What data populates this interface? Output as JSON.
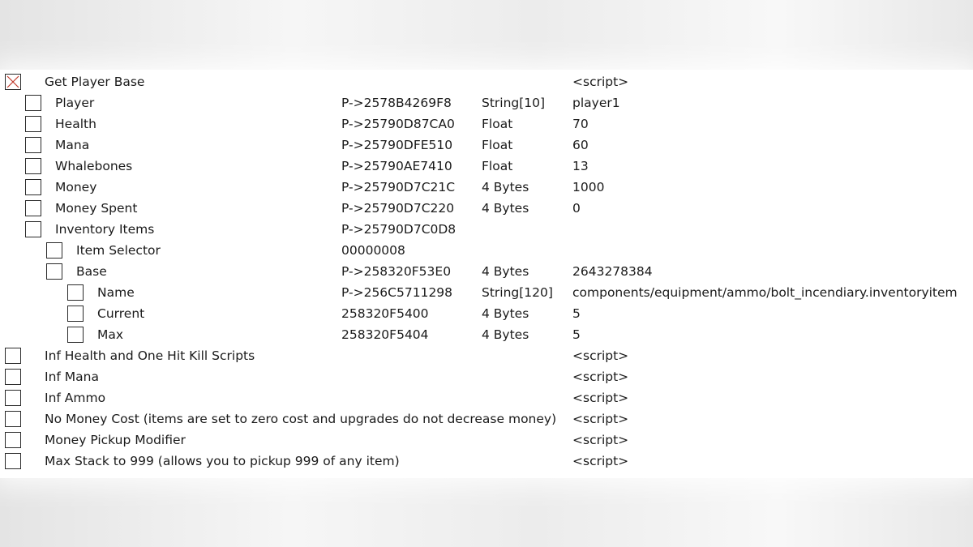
{
  "entries": [
    {
      "level": 0,
      "checked": true,
      "description": "Get Player Base",
      "address": "",
      "type": "",
      "value": "<script>"
    },
    {
      "level": 1,
      "checked": false,
      "description": "Player",
      "address": "P->2578B4269F8",
      "type": "String[10]",
      "value": "player1"
    },
    {
      "level": 1,
      "checked": false,
      "description": "Health",
      "address": "P->25790D87CA0",
      "type": "Float",
      "value": "70"
    },
    {
      "level": 1,
      "checked": false,
      "description": "Mana",
      "address": "P->25790DFE510",
      "type": "Float",
      "value": "60"
    },
    {
      "level": 1,
      "checked": false,
      "description": "Whalebones",
      "address": "P->25790AE7410",
      "type": "Float",
      "value": "13"
    },
    {
      "level": 1,
      "checked": false,
      "description": "Money",
      "address": "P->25790D7C21C",
      "type": "4 Bytes",
      "value": "1000"
    },
    {
      "level": 1,
      "checked": false,
      "description": "Money Spent",
      "address": "P->25790D7C220",
      "type": "4 Bytes",
      "value": "0"
    },
    {
      "level": 1,
      "checked": false,
      "description": "Inventory Items",
      "address": "P->25790D7C0D8",
      "type": "",
      "value": ""
    },
    {
      "level": 2,
      "checked": false,
      "description": "Item Selector",
      "address": "00000008",
      "type": "",
      "value": ""
    },
    {
      "level": 2,
      "checked": false,
      "description": "Base",
      "address": "P->258320F53E0",
      "type": "4 Bytes",
      "value": "2643278384"
    },
    {
      "level": 3,
      "checked": false,
      "description": "Name",
      "address": "P->256C5711298",
      "type": "String[120]",
      "value": "components/equipment/ammo/bolt_incendiary.inventoryitem"
    },
    {
      "level": 3,
      "checked": false,
      "description": "Current",
      "address": "258320F5400",
      "type": "4 Bytes",
      "value": "5"
    },
    {
      "level": 3,
      "checked": false,
      "description": "Max",
      "address": "258320F5404",
      "type": "4 Bytes",
      "value": "5"
    },
    {
      "level": 0,
      "checked": false,
      "description": "Inf Health and One Hit Kill Scripts",
      "address": "",
      "type": "",
      "value": "<script>"
    },
    {
      "level": 0,
      "checked": false,
      "description": "Inf Mana",
      "address": "",
      "type": "",
      "value": "<script>"
    },
    {
      "level": 0,
      "checked": false,
      "description": "Inf Ammo",
      "address": "",
      "type": "",
      "value": "<script>"
    },
    {
      "level": 0,
      "checked": false,
      "description": "No Money Cost (items are set to zero cost and upgrades do not decrease money)",
      "address": "",
      "type": "",
      "value": "<script>"
    },
    {
      "level": 0,
      "checked": false,
      "description": "Money Pickup Modifier",
      "address": "",
      "type": "",
      "value": "<script>"
    },
    {
      "level": 0,
      "checked": false,
      "description": "Max Stack to 999 (allows you to pickup 999 of any item)",
      "address": "",
      "type": "",
      "value": "<script>"
    }
  ],
  "colors": {
    "checked_x": "#c0392b",
    "checkbox_border": "#2a2a2a"
  }
}
